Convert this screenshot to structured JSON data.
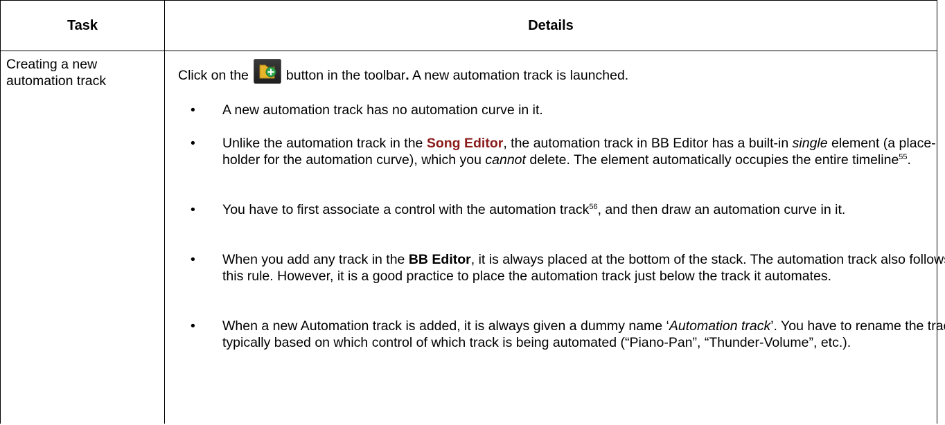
{
  "table": {
    "headers": {
      "task": "Task",
      "details": "Details"
    },
    "row": {
      "task": "Creating a new automation track",
      "intro": {
        "before_icon": "Click on the",
        "icon": "new-automation-track-icon",
        "after_icon": "button in the toolbar",
        "dot": ".",
        "tail": " A new automation track is launched."
      },
      "bullets": [
        {
          "text": "A new automation track has no automation curve in it."
        },
        {
          "t1": "Unlike the automation track in the ",
          "link": "Song Editor",
          "t2": ", the automation track in BB Editor has a built-in ",
          "em1": "single",
          "t3": " element (a place-holder for the automation curve), which you ",
          "em2": "cannot",
          "t4": " delete. The element automatically occupies the entire timeline",
          "fn": "55",
          "t5": "."
        },
        {
          "t1": "You have to first associate a control with the automation track",
          "fn": "56",
          "t2": ", and then draw an automation curve in it."
        },
        {
          "t1": "When you add any track in the ",
          "bold": "BB Editor",
          "t2": ", it is always placed at the bottom of the stack. The automation track also follows this rule. However, it is a good practice to place the automation track just below the track it automates."
        },
        {
          "t1": "When a new Automation track is added, it is always given a dummy name ‘",
          "em": "Automation track",
          "t2": "’. You have to rename the track; typically based on which control of which track is being automated (“Piano-Pan”, “Thunder-Volume”, etc.)."
        }
      ],
      "bullet_glyph": "•"
    },
    "colors": {
      "link": "#8b1a1a",
      "icon_folder": "#e8b52a",
      "icon_plus": "#2fa84f"
    }
  }
}
